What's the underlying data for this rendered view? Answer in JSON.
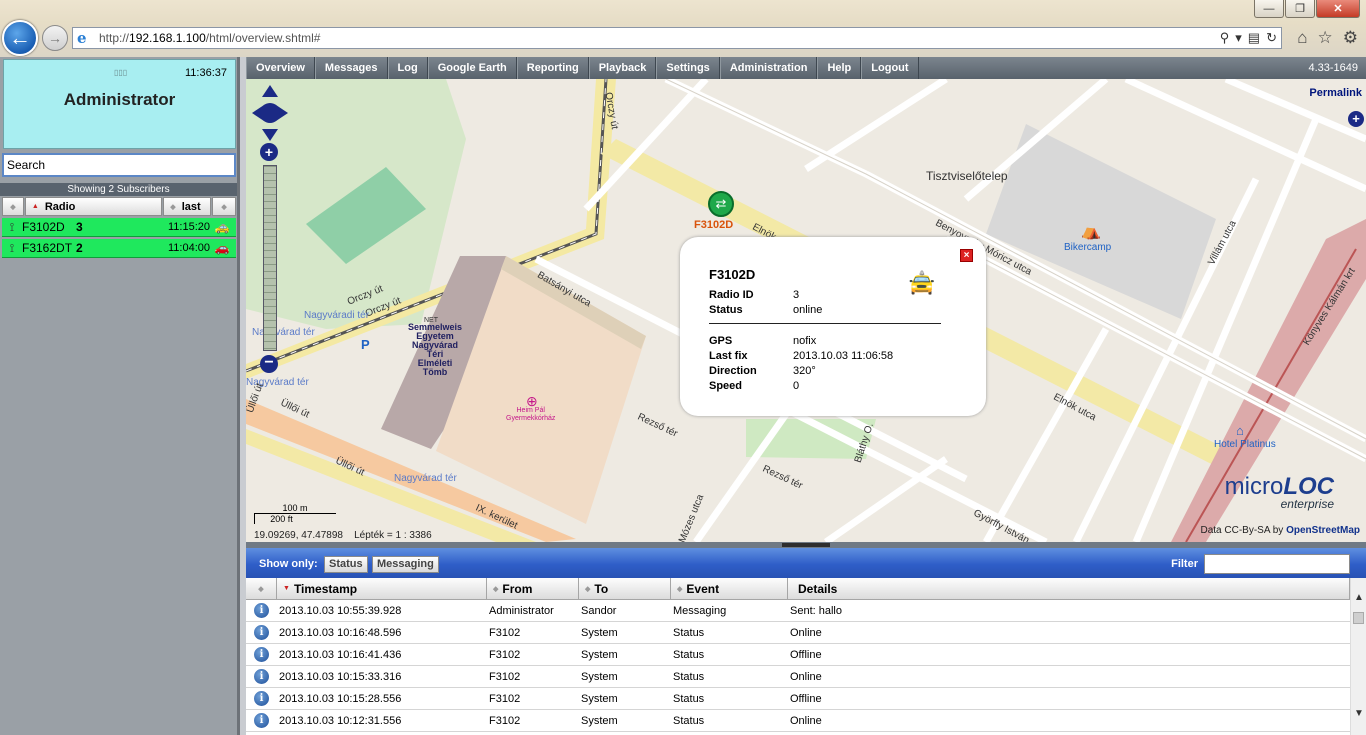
{
  "browser": {
    "url_prefix": "http://",
    "url_host": "192.168.1.100",
    "url_path": "/html/overview.shtml#",
    "window_min": "—",
    "window_max": "❐",
    "window_close": "✕"
  },
  "left": {
    "signal": "▯▯▯",
    "clock": "11:36:37",
    "user": "Administrator",
    "search_placeholder": "Search",
    "showing": "Showing 2 Subscribers",
    "col_radio": "Radio",
    "col_last": "last",
    "subscribers": [
      {
        "name": "F3102D",
        "num": "3",
        "time": "11:15:20",
        "icon": "taxi-icon"
      },
      {
        "name": "F3162DT",
        "num": "2",
        "time": "11:04:00",
        "icon": "car-icon"
      }
    ]
  },
  "nav": {
    "items": [
      "Overview",
      "Messages",
      "Log",
      "Google Earth",
      "Reporting",
      "Playback",
      "Settings",
      "Administration",
      "Help",
      "Logout"
    ],
    "version": "4.33-1649"
  },
  "map": {
    "permalink": "Permalink",
    "scale_m": "100 m",
    "scale_ft": "200 ft",
    "coords": "19.09269, 47.47898",
    "scale_ratio": "Lépték = 1 : 3386",
    "attribution_prefix": "Data CC-By-SA by ",
    "attribution_link": "OpenStreetMap",
    "brand_a": "micro",
    "brand_b": "LOC",
    "brand_sub": "enterprise",
    "marker_label": "F3102D",
    "labels": {
      "tisztviselotelep": "Tisztviselőtelep",
      "benyovszky": "Benyovszky Móricz utca",
      "bikercamp": "Bikercamp",
      "villam": "Villám utca",
      "konyves": "Könyves Kálmán krt",
      "batsanyi": "Batsányi utca",
      "orczy1": "Orczy út",
      "orczy2": "Orczy út",
      "orczy3": "Orczy út",
      "nagyvarad1": "Nagyváradi tér",
      "nagyvarad2": "Nagyvárad tér",
      "nagyvarad3": "Nagyvárad tér",
      "nagyvarad4": "Nagyvárad tér",
      "semmelweis": "Semmelweis\nEgyetem\nNagyvárad\nTéri\nElméleti\nTömb",
      "heim": "Heim Pál\nGyermekkórház",
      "elnok": "Elnök utca",
      "elnok2": "Elnök",
      "rezso1": "Rezső tér",
      "rezso2": "Rezső tér",
      "hotel": "Hotel Platinus",
      "gyorffy": "Györffy István",
      "ulloi1": "Üllői út",
      "ulloi2": "Üllői út",
      "ulloi3": "Üllői út",
      "ix": "IX. kerület",
      "mozes": "Mózes utca",
      "blathy": "Bláthy O.",
      "parking": "P",
      "net": "NET"
    }
  },
  "popup": {
    "title": "F3102D",
    "radio_id_k": "Radio ID",
    "radio_id_v": "3",
    "status_k": "Status",
    "status_v": "online",
    "gps_k": "GPS",
    "gps_v": "nofix",
    "lastfix_k": "Last fix",
    "lastfix_v": "2013.10.03 11:06:58",
    "direction_k": "Direction",
    "direction_v": "320°",
    "speed_k": "Speed",
    "speed_v": "0"
  },
  "events": {
    "show_only": "Show only:",
    "btn_status": "Status",
    "btn_messaging": "Messaging",
    "filter": "Filter",
    "headers": [
      "Timestamp",
      "From",
      "To",
      "Event",
      "Details"
    ],
    "rows": [
      {
        "ts": "2013.10.03 10:55:39.928",
        "from": "Administrator",
        "to": "Sandor",
        "event": "Messaging",
        "details": "Sent: hallo"
      },
      {
        "ts": "2013.10.03 10:16:48.596",
        "from": "F3102",
        "to": "System",
        "event": "Status",
        "details": "Online"
      },
      {
        "ts": "2013.10.03 10:16:41.436",
        "from": "F3102",
        "to": "System",
        "event": "Status",
        "details": "Offline"
      },
      {
        "ts": "2013.10.03 10:15:33.316",
        "from": "F3102",
        "to": "System",
        "event": "Status",
        "details": "Online"
      },
      {
        "ts": "2013.10.03 10:15:28.556",
        "from": "F3102",
        "to": "System",
        "event": "Status",
        "details": "Offline"
      },
      {
        "ts": "2013.10.03 10:12:31.556",
        "from": "F3102",
        "to": "System",
        "event": "Status",
        "details": "Online"
      }
    ]
  }
}
